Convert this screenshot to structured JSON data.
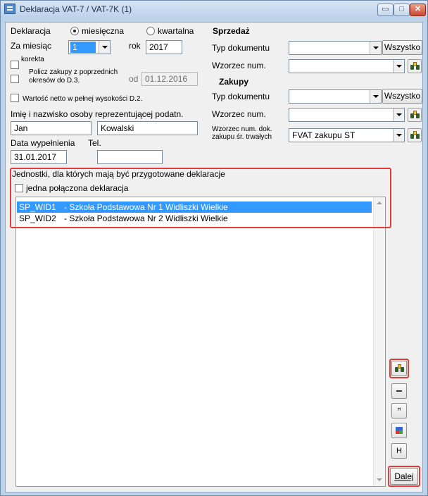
{
  "window": {
    "title": "Deklaracja VAT-7 / VAT-7K (1)",
    "controls": {
      "minimize": "▭",
      "maximize": "□",
      "close": "✕"
    }
  },
  "declaration": {
    "label": "Deklaracja",
    "radio_monthly": "miesięczna",
    "radio_quarterly": "kwartalna",
    "selected": "miesięczna"
  },
  "period": {
    "month_label": "Za miesiąc",
    "month_value": "1",
    "year_label": "rok",
    "year_value": "2017"
  },
  "options": {
    "correction_label": "korekta",
    "previous_purchases_label_line1": "Policz zakupy z poprzednich",
    "previous_purchases_label_line2": "okresów do D.3.",
    "from_label": "od",
    "from_date": "01.12.2016",
    "net_value_label": "Wartość netto w pełnej wysokości D.2."
  },
  "representative": {
    "label": "Imię i nazwisko osoby reprezentującej podatn.",
    "first_name": "Jan",
    "last_name": "Kowalski",
    "fill_date_label": "Data wypełnienia",
    "fill_date": "31.01.2017",
    "phone_label": "Tel.",
    "phone": ""
  },
  "sales": {
    "header": "Sprzedaż",
    "doc_type_label": "Typ dokumentu",
    "doc_type_value": "",
    "all_button": "Wszystko",
    "pattern_label": "Wzorzec num.",
    "pattern_value": ""
  },
  "purchases": {
    "header": "Zakupy",
    "doc_type_label": "Typ dokumentu",
    "doc_type_value": "",
    "all_button": "Wszystko",
    "pattern_label": "Wzorzec num.",
    "pattern_value": "",
    "fixed_assets_label_line1": "Wzorzec num. dok.",
    "fixed_assets_label_line2": "zakupu śr. trwałych",
    "fixed_assets_value": "FVAT zakupu ST"
  },
  "units": {
    "header": "Jednostki, dla których mają być przygotowane deklaracje",
    "combined_label": "jedna połączona deklaracja",
    "items": [
      {
        "code": "SP_WID1",
        "name": "- Szkoła Podstawowa Nr 1 Widliszki Wielkie"
      },
      {
        "code": "SP_WID2",
        "name": "- Szkoła Podstawowa Nr 2 Widliszki Wielkie"
      }
    ]
  },
  "side_buttons": {
    "find_icon": "binoculars-icon",
    "remove_icon": "minus-icon",
    "sum_icon": "sigma-icon",
    "grid_icon": "grid-icon",
    "h_label": "H",
    "next_label": "Dalej"
  },
  "colors": {
    "selection": "#3399ff",
    "highlight_box": "#e53b3b",
    "title_bar": "#bcd3ea"
  }
}
